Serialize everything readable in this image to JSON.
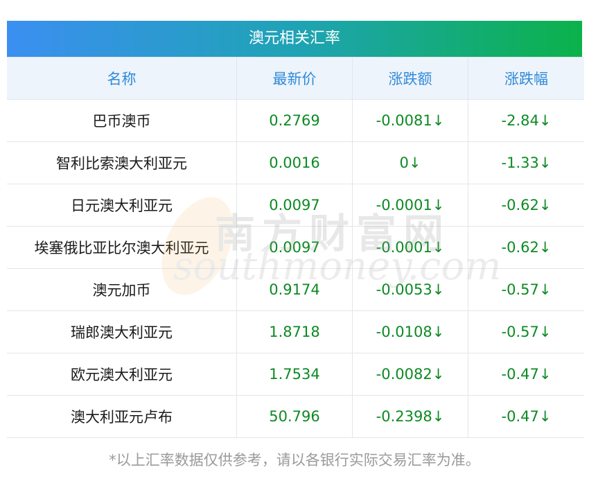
{
  "header": {
    "title": "澳元相关汇率"
  },
  "table": {
    "columns": [
      "名称",
      "最新价",
      "涨跌额",
      "涨跌幅"
    ],
    "rows": [
      {
        "name": "巴币澳币",
        "price": "0.2769",
        "change": "-0.0081↓",
        "pct": "-2.84↓"
      },
      {
        "name": "智利比索澳大利亚元",
        "price": "0.0016",
        "change": "0↓",
        "pct": "-1.33↓"
      },
      {
        "name": "日元澳大利亚元",
        "price": "0.0097",
        "change": "-0.0001↓",
        "pct": "-0.62↓"
      },
      {
        "name": "埃塞俄比亚比尔澳大利亚元",
        "price": "0.0097",
        "change": "-0.0001↓",
        "pct": "-0.62↓"
      },
      {
        "name": "澳元加币",
        "price": "0.9174",
        "change": "-0.0053↓",
        "pct": "-0.57↓"
      },
      {
        "name": "瑞郎澳大利亚元",
        "price": "1.8718",
        "change": "-0.0108↓",
        "pct": "-0.57↓"
      },
      {
        "name": "欧元澳大利亚元",
        "price": "1.7534",
        "change": "-0.0082↓",
        "pct": "-0.47↓"
      },
      {
        "name": "澳大利亚元卢布",
        "price": "50.796",
        "change": "-0.2398↓",
        "pct": "-0.47↓"
      }
    ]
  },
  "watermark": {
    "cn": "南方财富网",
    "en": "southmoney.com"
  },
  "footer": {
    "note": "*以上汇率数据仅供参考，请以各银行实际交易汇率为准。"
  },
  "colors": {
    "header_start": "#3b8ff1",
    "header_end": "#0bb24a",
    "column_header_text": "#2f8ad8",
    "value_green": "#0c8a23"
  }
}
